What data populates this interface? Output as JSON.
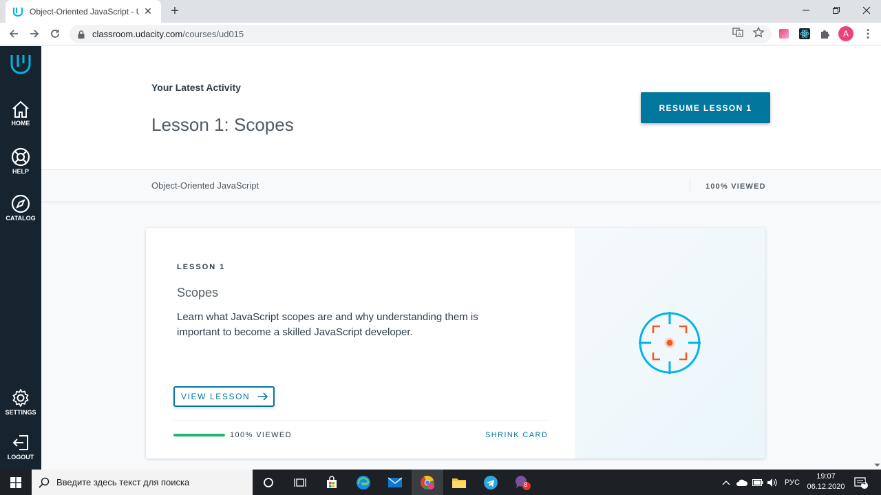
{
  "browser": {
    "tab_title": "Object-Oriented JavaScript - Udacity",
    "new_tab_label": "+",
    "url_host": "classroom.udacity.com",
    "url_path": "/courses/ud015",
    "profile_initial": "A"
  },
  "sidebar": {
    "items": [
      {
        "label": "HOME",
        "icon": "home-icon"
      },
      {
        "label": "HELP",
        "icon": "lifebuoy-icon"
      },
      {
        "label": "CATALOG",
        "icon": "compass-icon"
      },
      {
        "label": "SETTINGS",
        "icon": "gear-icon"
      },
      {
        "label": "LOGOUT",
        "icon": "logout-icon"
      }
    ]
  },
  "hero": {
    "latest_label": "Your Latest Activity",
    "lesson_title": "Lesson 1: Scopes",
    "resume_button": "RESUME LESSON 1"
  },
  "subbar": {
    "course_name": "Object-Oriented JavaScript",
    "viewed": "100% VIEWED"
  },
  "card": {
    "kicker": "LESSON 1",
    "title": "Scopes",
    "description": "Learn what JavaScript scopes are and why understanding them is important to become a skilled JavaScript developer.",
    "view_button": "VIEW LESSON",
    "progress_fraction": 1.0,
    "progress_label": "100% VIEWED",
    "shrink_label": "SHRINK CARD",
    "illustration": "target-icon"
  },
  "taskbar": {
    "search_placeholder": "Введите здесь текст для поиска",
    "language": "РУС",
    "time": "19:07",
    "date": "06.12.2020",
    "notification_count": "4",
    "viber_badge": "8"
  },
  "colors": {
    "brand_blue": "#02779e",
    "sidebar_bg": "#15242f",
    "progress_green": "#1fb86b",
    "udacity_logo": "#02b3e4"
  }
}
